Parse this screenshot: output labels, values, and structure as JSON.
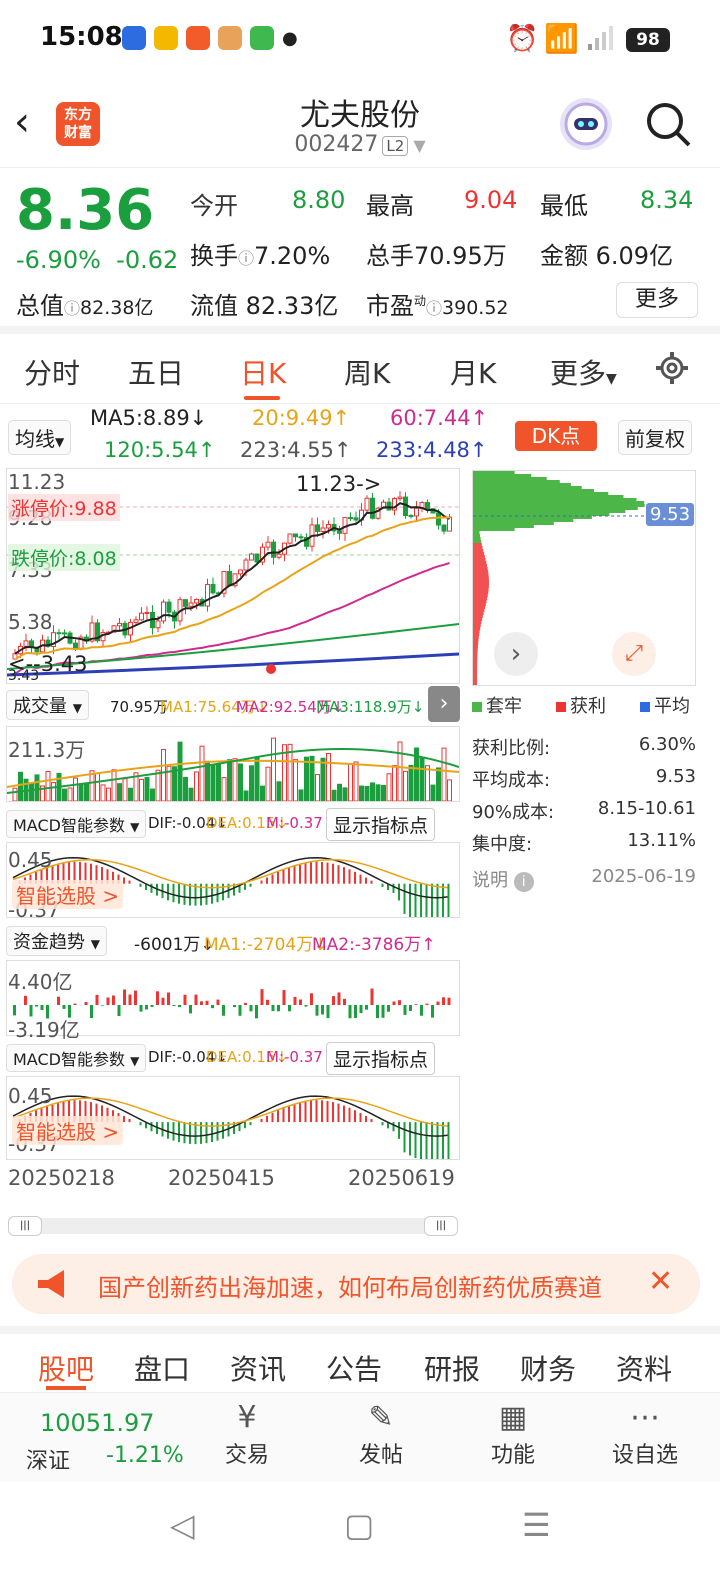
{
  "status": {
    "time": "15:08",
    "battery": "98"
  },
  "header": {
    "title": "尤夫股份",
    "code": "002427",
    "level": "L2",
    "logo_line1": "东方",
    "logo_line2": "财富"
  },
  "quote": {
    "price": "8.36",
    "change_pct": "-6.90%",
    "change": "-0.62",
    "open_label": "今开",
    "open": "8.80",
    "high_label": "最高",
    "high": "9.04",
    "low_label": "最低",
    "low": "8.34",
    "turnover_label": "换手",
    "turnover": "7.20%",
    "volume_label": "总手",
    "volume": "70.95万",
    "amount_label": "金额",
    "amount": "6.09亿",
    "mktcap_label": "总值",
    "mktcap": "82.38亿",
    "float_label": "流值",
    "float": "82.33亿",
    "pe_label": "市盈",
    "pe_sup": "动",
    "pe": "390.52",
    "more": "更多"
  },
  "tabs": [
    "分时",
    "五日",
    "日K",
    "周K",
    "月K",
    "更多"
  ],
  "ma": {
    "selector": "均线",
    "ma5": "MA5:8.89↓",
    "ma20": "20:9.49↑",
    "ma60": "60:7.44↑",
    "ma120": "120:5.54↑",
    "ma223": "223:4.55↑",
    "ma233": "233:4.48↑",
    "dk": "DK点",
    "adjust": "前复权"
  },
  "kchart": {
    "y_top": "11.23",
    "y_mid1": "9.28",
    "y_mid2": "7.33",
    "y_low": "5.38",
    "limit_up": "涨停价:9.88",
    "limit_down": "跌停价:8.08",
    "high_note": "11.23->",
    "low_note": "<--3.43",
    "low_tail": "3.43",
    "bottom_tail": "3.43"
  },
  "chip": {
    "price_tag": "9.53",
    "leg_trapped": "套牢",
    "leg_profit": "获利",
    "leg_avg": "平均",
    "rows": [
      [
        "获利比例:",
        "6.30%"
      ],
      [
        "平均成本:",
        "9.53"
      ],
      [
        "90%成本:",
        "8.15-10.61"
      ],
      [
        "集中度:",
        "13.11%"
      ]
    ],
    "note_label": "说明",
    "note_date": "2025-06-19"
  },
  "vol": {
    "selector": "成交量",
    "vals": "70.95万",
    "ma1": "MA1:75.64万↓",
    "ma2": "MA2:92.54万↓",
    "ma3": "MA3:118.9万↓",
    "ytop": "211.3万"
  },
  "macd1": {
    "selector": "MACD智能参数",
    "dif": "DIF:-0.04↓",
    "dea": "DEA:0.15↓",
    "m": "M:-0.37↓",
    "btn": "显示指标点",
    "ytop": "0.45",
    "ybot": "-0.37",
    "promo": "智能选股 >"
  },
  "fund": {
    "selector": "资金趋势",
    "v": "-6001万↓",
    "ma1": "MA1:-2704万↓",
    "ma2": "MA2:-3786万↑",
    "ytop": "4.40亿",
    "ybot": "-3.19亿"
  },
  "macd2": {
    "selector": "MACD智能参数",
    "dif": "DIF:-0.04↓",
    "dea": "DEA:0.15↓",
    "m": "M:-0.37↓",
    "btn": "显示指标点",
    "ytop": "0.45",
    "ybot": "-0.37",
    "promo": "智能选股 >"
  },
  "dates": [
    "20250218",
    "20250415",
    "20250619"
  ],
  "banner": "国产创新药出海加速，如何布局创新药优质赛道",
  "btabs": [
    "股吧",
    "盘口",
    "资讯",
    "公告",
    "研报",
    "财务",
    "资料"
  ],
  "bottom": {
    "index_val": "10051.97",
    "index_name": "深证",
    "index_chg": "-1.21%",
    "items": [
      "交易",
      "发帖",
      "功能",
      "设自选"
    ]
  }
}
